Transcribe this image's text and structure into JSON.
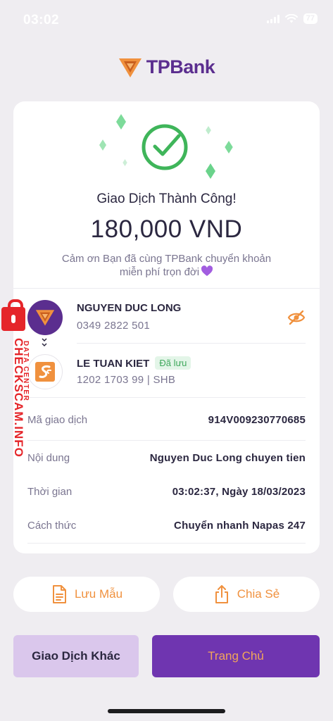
{
  "status_bar": {
    "time": "03:02",
    "battery": "77"
  },
  "brand": {
    "name_tp": "TP",
    "name_bank": "Bank",
    "primary_color": "#5b2e8f",
    "accent_color": "#f0913e"
  },
  "result": {
    "title": "Giao Dịch Thành Công!",
    "amount": "180,000 VND",
    "thanks_line1": "Cảm ơn Bạn đã cùng TPBank chuyển khoản",
    "thanks_line2": "miễn phí trọn đời",
    "success_color": "#3fb55a"
  },
  "sender": {
    "name": "NGUYEN DUC LONG",
    "account": "0349 2822 501",
    "hide_icon": "eye-off-icon"
  },
  "receiver": {
    "name": "LE TUAN KIET",
    "badge": "Đã lưu",
    "account": "1202 1703 99 | SHB"
  },
  "details": [
    {
      "label": "Mã giao dịch",
      "value": "914V009230770685"
    },
    {
      "label": "Nội dung",
      "value": "Nguyen Duc Long chuyen tien"
    },
    {
      "label": "Thời gian",
      "value": "03:02:37, Ngày 18/03/2023"
    },
    {
      "label": "Cách thức",
      "value": "Chuyển nhanh Napas 247"
    }
  ],
  "actions": {
    "save_template": "Lưu Mẫu",
    "share": "Chia Sẻ",
    "other_transaction": "Giao Dịch Khác",
    "home": "Trang Chủ"
  },
  "watermark": {
    "site": "CHECKSCAM.INFO",
    "tag": "DATA CENTER"
  }
}
